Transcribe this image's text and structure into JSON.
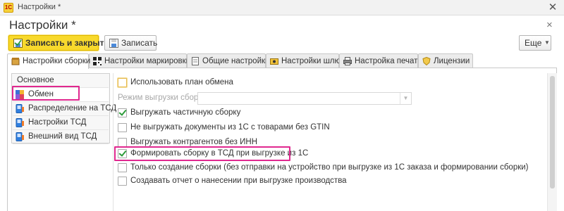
{
  "window": {
    "title": "Настройки *",
    "logo_text": "1С",
    "close": "✕"
  },
  "page": {
    "title": "Настройки *",
    "close": "×"
  },
  "toolbar": {
    "save_close_label": "Записать и закрыть",
    "save_label": "Записать",
    "more_label": "Еще",
    "more_caret": "▼"
  },
  "tabs": [
    {
      "label": "Настройки сборки",
      "icon": "package-settings-icon",
      "active": true
    },
    {
      "label": "Настройки маркировки",
      "icon": "qr-code-icon",
      "active": false
    },
    {
      "label": "Общие настройки",
      "icon": "document-settings-icon",
      "active": false
    },
    {
      "label": "Настройки шлюз",
      "icon": "gateway-icon",
      "active": false
    },
    {
      "label": "Настройка печати",
      "icon": "printer-icon",
      "active": false
    },
    {
      "label": "Лицензии",
      "icon": "license-shield-icon",
      "active": false
    }
  ],
  "sidebar": {
    "items": [
      {
        "label": "Основное",
        "icon": "",
        "selected": false
      },
      {
        "label": "Обмен",
        "icon": "exchange-icon",
        "selected": true
      },
      {
        "label": "Распределение на ТСД",
        "icon": "device-icon",
        "selected": false
      },
      {
        "label": "Настройки ТСД",
        "icon": "device-icon",
        "selected": false
      },
      {
        "label": "Внешний вид ТСД",
        "icon": "device-icon",
        "selected": false
      }
    ]
  },
  "options": {
    "use_plan": {
      "label": "Использовать план обмена",
      "checked": false
    },
    "mode": {
      "label": "Режим выгрузки сборки:",
      "value": "",
      "caret": "▼"
    },
    "partial": {
      "label": "Выгружать частичную сборку",
      "checked": true
    },
    "no_gtin": {
      "label": "Не выгружать документы из 1С с товарами без GTIN",
      "checked": false
    },
    "no_inn": {
      "label": "Выгружать контрагентов без ИНН",
      "checked": false
    },
    "form_on_export": {
      "label": "Формировать сборку в ТСД при выгрузке из 1С",
      "checked": true
    },
    "create_only": {
      "label": "Только создание сборки (без отправки на устройство при выгрузке из 1С заказа и формировании сборки)",
      "checked": false
    },
    "report": {
      "label": "Создавать отчет о нанесении при выгрузке производства",
      "checked": false
    }
  },
  "colors": {
    "primary_button": "#f8d92c",
    "highlight": "#e0288f",
    "check": "#2d9b3a"
  }
}
